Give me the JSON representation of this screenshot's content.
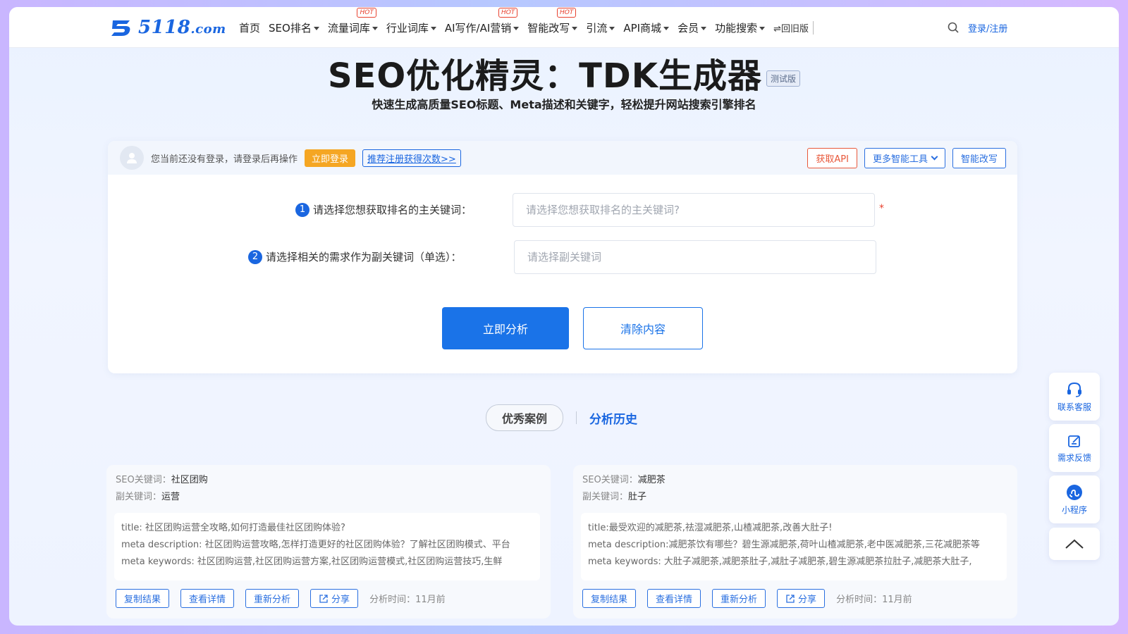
{
  "header": {
    "logo_text": "5118",
    "logo_suffix": ".com",
    "nav": [
      {
        "label": "首页",
        "caret": false,
        "hot": false
      },
      {
        "label": "SEO排名",
        "caret": true,
        "hot": false
      },
      {
        "label": "流量词库",
        "caret": true,
        "hot": true
      },
      {
        "label": "行业词库",
        "caret": true,
        "hot": false
      },
      {
        "label": "AI写作/AI营销",
        "caret": true,
        "hot": true
      },
      {
        "label": "智能改写",
        "caret": true,
        "hot": true
      },
      {
        "label": "引流",
        "caret": true,
        "hot": false
      },
      {
        "label": "API商城",
        "caret": true,
        "hot": false
      },
      {
        "label": "会员",
        "caret": true,
        "hot": false
      },
      {
        "label": "功能搜索",
        "caret": true,
        "hot": false
      }
    ],
    "hot_label": "HOT",
    "old_version": "⇌回旧版",
    "login": "登录/注册"
  },
  "hero": {
    "title": "SEO优化精灵：TDK生成器",
    "badge": "测试版",
    "subtitle": "快速生成高质量SEO标题、Meta描述和关键字，轻松提升网站搜索引擎排名"
  },
  "toolbar": {
    "notice": "您当前还没有登录，请登录后再操作",
    "login_now": "立即登录",
    "register_link": "推荐注册获得次数>>",
    "get_api": "获取API",
    "more_tools": "更多智能工具",
    "smart_rewrite": "智能改写"
  },
  "form": {
    "step1_num": "1",
    "step1_label": "请选择您想获取排名的主关键词：",
    "step1_placeholder": "请选择您想获取排名的主关键词?",
    "required_mark": "*",
    "step2_num": "2",
    "step2_label": "请选择相关的需求作为副关键词（单选）：",
    "step2_placeholder": "请选择副关键词",
    "analyze": "立即分析",
    "clear": "清除内容"
  },
  "tabs": {
    "cases": "优秀案例",
    "history": "分析历史"
  },
  "cases": [
    {
      "seo_kw_label": "SEO关键词：",
      "seo_kw": "社区团购",
      "sub_kw_label": "副关键词：",
      "sub_kw": "运营",
      "title": "title: 社区团购运营全攻略,如何打造最佳社区团购体验?",
      "description": "meta description: 社区团购运营攻略,怎样打造更好的社区团购体验？了解社区团购模式、平台",
      "keywords": "meta keywords: 社区团购运营,社区团购运营方案,社区团购运营模式,社区团购运营技巧,生鲜",
      "copy": "复制结果",
      "detail": "查看详情",
      "reanalyze": "重新分析",
      "share": "分享",
      "time": "分析时间：11月前"
    },
    {
      "seo_kw_label": "SEO关键词：",
      "seo_kw": "减肥茶",
      "sub_kw_label": "副关键词：",
      "sub_kw": "肚子",
      "title": "title:最受欢迎的减肥茶,祛湿减肥茶,山楂减肥茶,改善大肚子!",
      "description": "meta description:减肥茶饮有哪些？碧生源减肥茶,荷叶山楂减肥茶,老中医减肥茶,三花减肥茶等",
      "keywords": "meta keywords: 大肚子减肥茶,减肥茶肚子,减肚子减肥茶,碧生源减肥茶拉肚子,减肥茶大肚子,",
      "copy": "复制结果",
      "detail": "查看详情",
      "reanalyze": "重新分析",
      "share": "分享",
      "time": "分析时间：11月前"
    }
  ],
  "sidebar": {
    "service": "联系客服",
    "feedback": "需求反馈",
    "miniprogram": "小程序"
  },
  "colors": {
    "brand": "#1a66e0",
    "primary_button": "#1a73e8",
    "orange": "#f5a623",
    "api_red": "#e8583a"
  }
}
